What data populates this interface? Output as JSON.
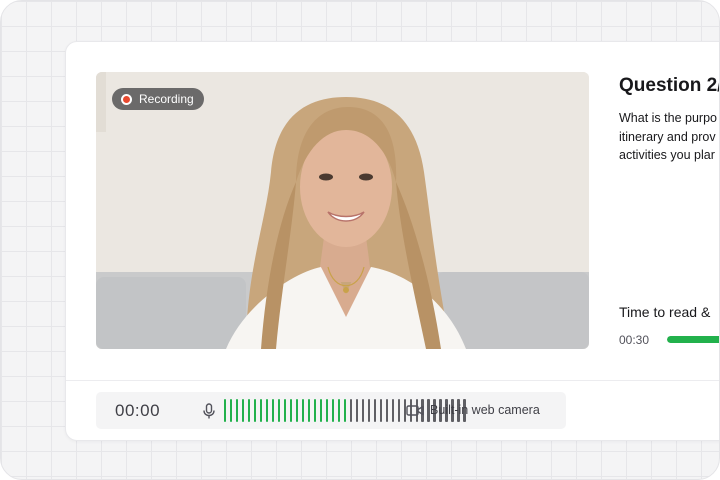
{
  "recording": {
    "label": "Recording"
  },
  "question": {
    "title": "Question 2/",
    "lines": [
      "What is the purpo",
      "itinerary and prov",
      "activities you plar"
    ]
  },
  "timer_panel": {
    "label": "Time to read &",
    "value": "00:30",
    "progress_fraction": 0.7
  },
  "controls": {
    "elapsed": "00:00",
    "mic_icon": "mic-icon",
    "level_bars_active": 21,
    "level_bars_total": 41,
    "camera_icon": "video-camera-icon",
    "camera_label": "Built-in web camera"
  },
  "colors": {
    "accent_green": "#22b14c",
    "meter_inactive": "#5f5f64",
    "recording_red": "#e8492f"
  }
}
